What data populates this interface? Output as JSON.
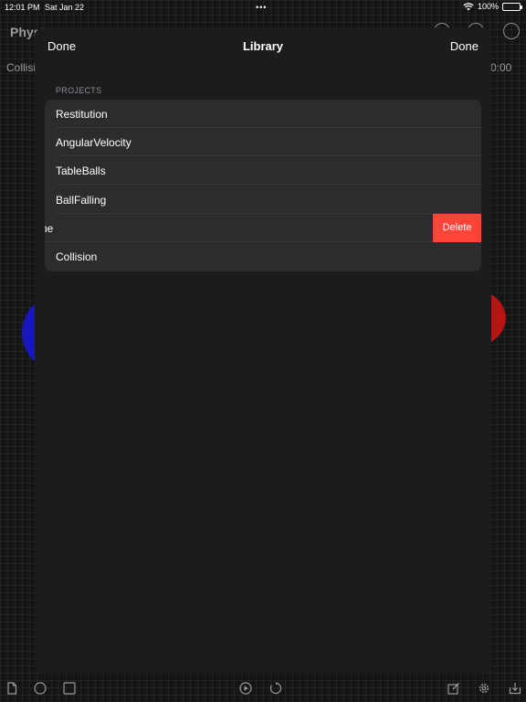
{
  "status_bar": {
    "time": "12:01 PM",
    "date": "Sat Jan 22",
    "dots": "•••",
    "battery": "100%",
    "wifi_icon": "wifi-icon",
    "battery_icon": "battery-icon"
  },
  "background": {
    "app_title": "Physics Playground",
    "subtitle": "Collision",
    "timer": "0:00",
    "ball_colors": [
      "#1818b8",
      "#b81414"
    ]
  },
  "modal": {
    "left_button": "Done",
    "title": "Library",
    "right_button": "Done",
    "section_header": "PROJECTS",
    "rows": [
      {
        "label": "Restitution"
      },
      {
        "label": "AngularVelocity"
      },
      {
        "label": "TableBalls"
      },
      {
        "label": "BallFalling"
      },
      {
        "label": "ne",
        "swiped": true
      },
      {
        "label": "Collision"
      }
    ],
    "delete_label": "Delete"
  },
  "colors": {
    "modal_bg": "#1c1c1e",
    "list_bg": "#2c2c2e",
    "delete": "#ff453a",
    "section_header": "#8e8e93"
  },
  "toolbar": {
    "icons": [
      "document-icon",
      "circle-shape-icon",
      "square-shape-icon",
      "play-icon",
      "reset-icon",
      "edit-icon",
      "settings-icon",
      "export-icon"
    ]
  }
}
